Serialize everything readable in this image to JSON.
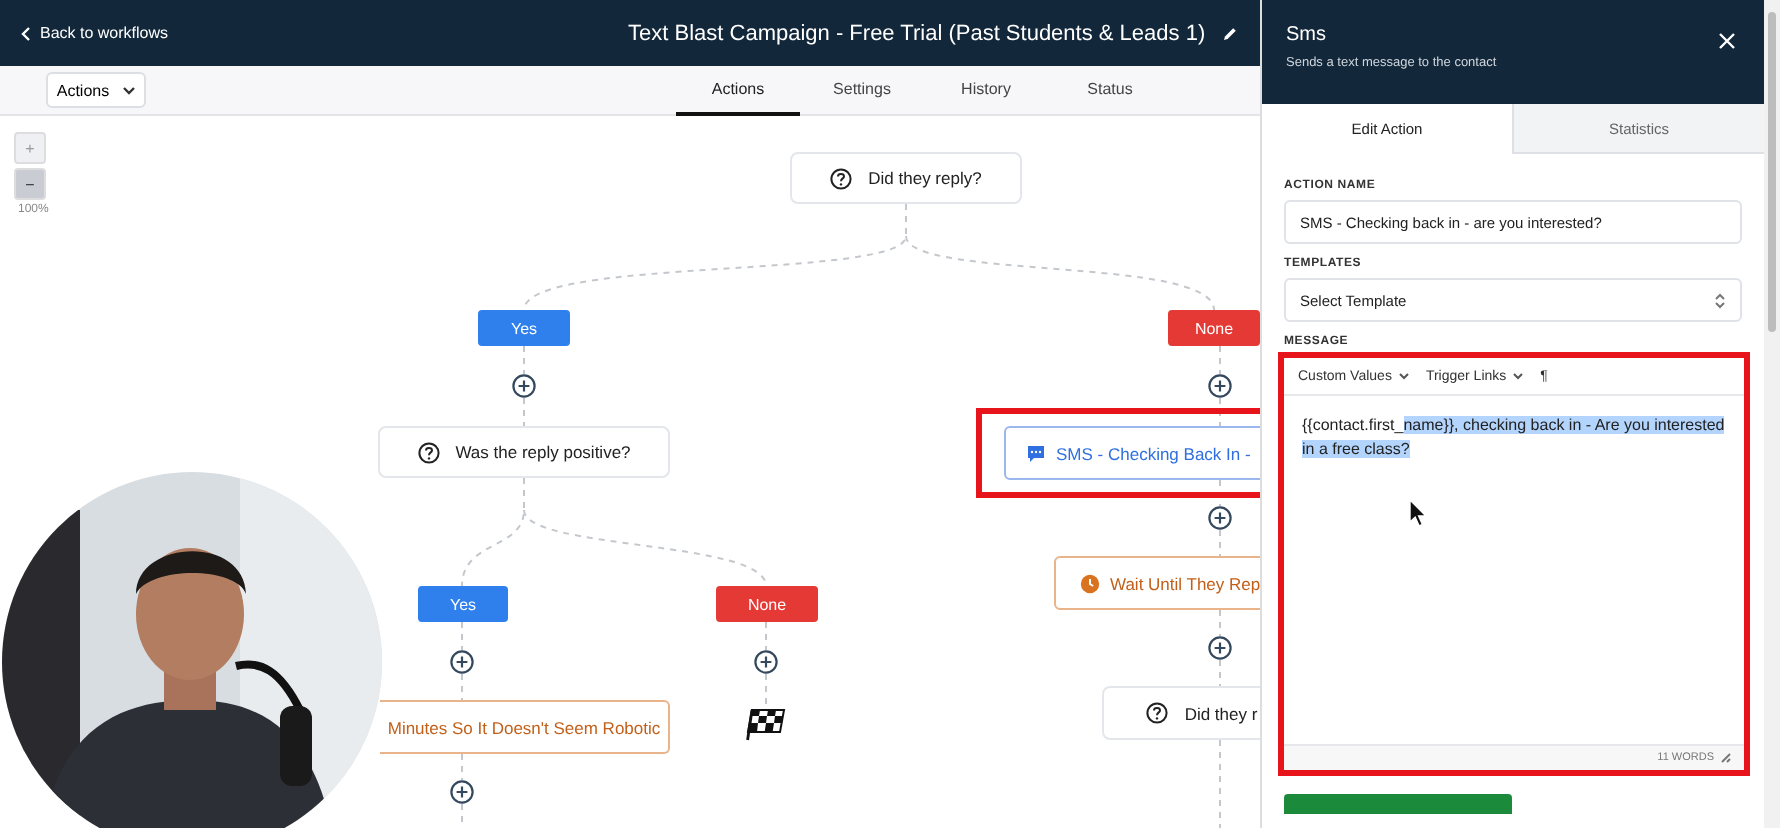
{
  "header": {
    "back_link": "Back to workflows",
    "title": "Text Blast Campaign - Free Trial (Past Students & Leads 1)"
  },
  "toolbar": {
    "dropdown": "Actions",
    "tabs": [
      {
        "label": "Actions",
        "selected": true
      },
      {
        "label": "Settings",
        "selected": false
      },
      {
        "label": "History",
        "selected": false
      },
      {
        "label": "Status",
        "selected": false
      }
    ]
  },
  "zoom": {
    "zoom_in": "+",
    "zoom_out": "−",
    "zoom_text": "100%"
  },
  "flow": {
    "nodes": [
      {
        "kind": "condition",
        "label": "Did they reply?"
      },
      {
        "kind": "branch",
        "label": "Yes",
        "color": "#2f80ed"
      },
      {
        "kind": "branch",
        "label": "None",
        "color": "#e53935"
      },
      {
        "kind": "add"
      },
      {
        "kind": "add"
      },
      {
        "kind": "condition",
        "label": "Was the reply positive?"
      },
      {
        "kind": "sms",
        "label": "SMS - Checking Back In -",
        "highlighted": true
      },
      {
        "kind": "add"
      },
      {
        "kind": "wait",
        "label": "Wait Until They Rep",
        "covered": false
      },
      {
        "kind": "add"
      },
      {
        "kind": "condition",
        "label": "Did they r"
      },
      {
        "kind": "branch",
        "label": "Yes",
        "color": "#2f80ed"
      },
      {
        "kind": "branch",
        "label": "None",
        "color": "#e53935"
      },
      {
        "kind": "add"
      },
      {
        "kind": "add"
      },
      {
        "kind": "wait",
        "label": "Minutes So It Doesn't Seem Robotic",
        "covered": true
      },
      {
        "kind": "end"
      },
      {
        "kind": "add"
      }
    ]
  },
  "panel": {
    "title": "Sms",
    "subtitle": "Sends a text message to the contact",
    "tabs": [
      {
        "label": "Edit Action",
        "selected": true
      },
      {
        "label": "Statistics",
        "selected": false
      }
    ],
    "fields": [
      {
        "kind": "input",
        "label": "ACTION NAME",
        "value": "SMS - Checking back in - are you interested?"
      },
      {
        "kind": "select",
        "label": "TEMPLATES",
        "value": "Select Template"
      }
    ],
    "message": {
      "label": "MESSAGE",
      "highlighted": true,
      "tools": [
        {
          "kind": "dropdown",
          "label": "Custom Values"
        },
        {
          "kind": "dropdown",
          "label": "Trigger Links"
        },
        {
          "kind": "button",
          "label": "¶"
        }
      ],
      "text_plain": "{{contact.first_",
      "text_selected": "name}}, checking back in - Are you interested in a free class?",
      "word_count": "11 WORDS"
    }
  }
}
